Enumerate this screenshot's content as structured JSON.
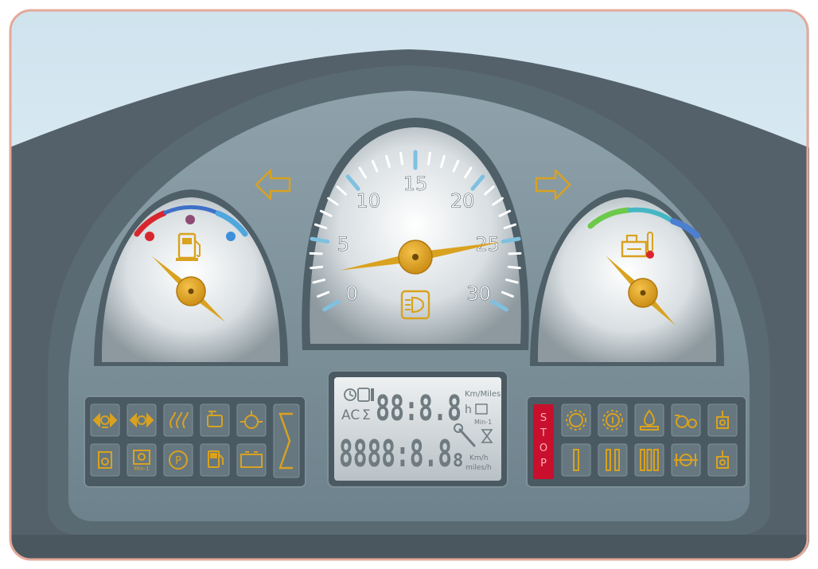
{
  "speedometer": {
    "scale_labels": [
      "0",
      "5",
      "10",
      "15",
      "20",
      "25",
      "30"
    ],
    "scale_min": 0,
    "scale_max": 30,
    "needle_value": 25,
    "center_icon": "headlight-icon"
  },
  "fuel_gauge": {
    "icon": "fuel-pump-icon",
    "needle_fraction": 0.02
  },
  "temp_gauge": {
    "icon": "coolant-temperature-icon",
    "needle_fraction": 0.05
  },
  "turn_signals": {
    "left_icon": "arrow-left-icon",
    "right_icon": "arrow-right-icon"
  },
  "lcd": {
    "upper_digits": "88:8.8",
    "lower_digits": "8888:8.8",
    "lower_suffix": "8",
    "unit_top": "Km/Miles",
    "unit_rpm": "Min-1",
    "unit_hours_prefix": "h",
    "unit_speed_1": "Km/h",
    "unit_speed_2": "miles/h",
    "ac_label": "AC",
    "sum_label": "Σ"
  },
  "left_panel": {
    "row1_icons": [
      "turn-trailer-2-icon",
      "turn-trailer-1-icon",
      "engine-preheat-icon",
      "engine-oil-icon",
      "fuel-filter-icon"
    ],
    "row2_icons": [
      "air-filter-icon",
      "rpm-min-icon",
      "parking-brake-icon",
      "fuel-reserve-icon",
      "battery-icon"
    ],
    "rpm_label": "Min-1",
    "sum_icon": "sigma-icon"
  },
  "right_panel": {
    "stop_label": "STOP",
    "row1_icons": [
      "transmission-oil-icon",
      "transmission-temp-icon",
      "hydraulic-oil-icon",
      "four-wheel-drive-icon",
      "front-pto-icon"
    ],
    "row2_icons": [
      "gear-range-1-icon",
      "gear-range-2-icon",
      "gear-range-3-icon",
      "differential-lock-icon",
      "rear-pto-icon"
    ]
  },
  "colors": {
    "accent_amber": "#d9a21f",
    "gauge_blue": "#7fc0e0",
    "stop_red": "#c8102e",
    "fuel_arc": [
      "#d9262e",
      "#3f6fc8",
      "#4fa7de"
    ],
    "temp_arc": [
      "#6cc94a",
      "#45b7c4",
      "#4c7fd0"
    ]
  }
}
